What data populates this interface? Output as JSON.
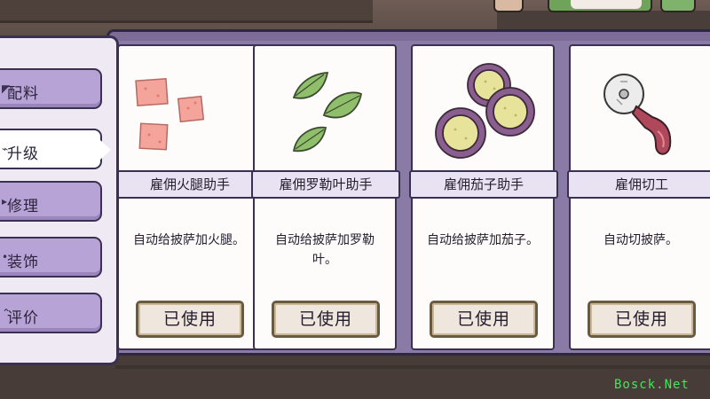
{
  "sidebar": {
    "tabs": [
      {
        "label": "配料",
        "icon": "ingredients-icon",
        "active": false
      },
      {
        "label": "升级",
        "icon": "upgrade-icon",
        "active": true
      },
      {
        "label": "修理",
        "icon": "repair-icon",
        "active": false
      },
      {
        "label": "装饰",
        "icon": "decoration-icon",
        "active": false
      },
      {
        "label": "评价",
        "icon": "rating-icon",
        "active": false
      }
    ]
  },
  "cards": [
    {
      "name": "雇佣火腿助手",
      "desc": "自动给披萨加火腿。",
      "button": "已使用",
      "art": "ham-cubes-icon"
    },
    {
      "name": "雇佣罗勒叶助手",
      "desc": "自动给披萨加罗勒叶。",
      "button": "已使用",
      "art": "basil-leaves-icon"
    },
    {
      "name": "雇佣茄子助手",
      "desc": "自动给披萨加茄子。",
      "button": "已使用",
      "art": "eggplant-slices-icon"
    },
    {
      "name": "雇佣切工",
      "desc": "自动切披萨。",
      "button": "已使用",
      "art": "pizza-cutter-icon"
    }
  ],
  "watermark": "Bosck.Net",
  "colors": {
    "panel": "#7e6c98",
    "tab": "#b7a3d6",
    "tab_active": "#ffffff",
    "button": "#efe7de",
    "watermark": "#3fe85a"
  }
}
